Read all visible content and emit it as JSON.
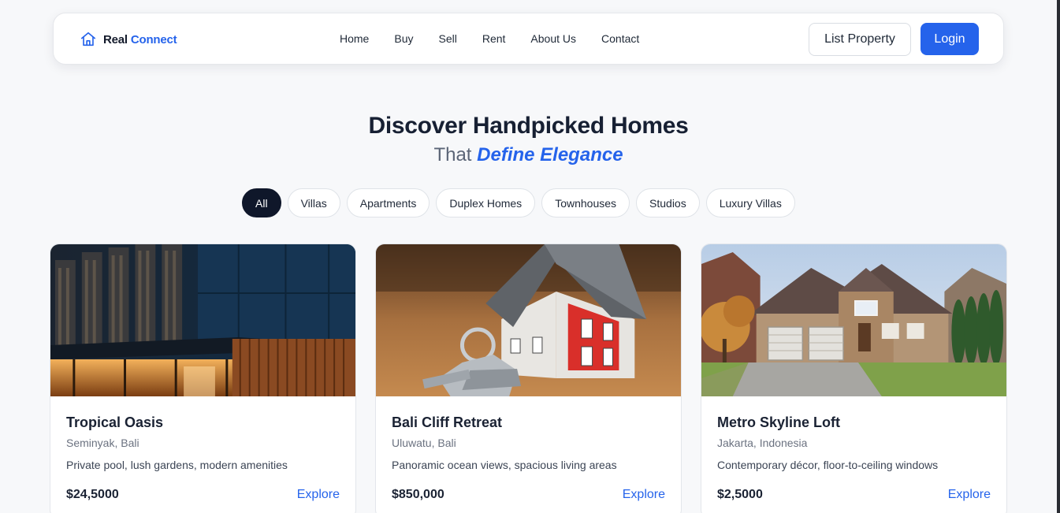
{
  "nav": {
    "brand_real": "Real",
    "brand_connect": "Connect",
    "links": [
      "Home",
      "Buy",
      "Sell",
      "Rent",
      "About Us",
      "Contact"
    ],
    "list_property": "List Property",
    "login": "Login"
  },
  "hero": {
    "title": "Discover Handpicked Homes",
    "subtitle_prefix": "That",
    "subtitle_accent": "Define Elegance"
  },
  "filters": [
    "All",
    "Villas",
    "Apartments",
    "Duplex Homes",
    "Townhouses",
    "Studios",
    "Luxury Villas"
  ],
  "cards": [
    {
      "title": "Tropical Oasis",
      "location": "Seminyak, Bali",
      "description": "Private pool, lush gardens, modern amenities",
      "price": "$24,5000",
      "cta": "Explore"
    },
    {
      "title": "Bali Cliff Retreat",
      "location": "Uluwatu, Bali",
      "description": "Panoramic ocean views, spacious living areas",
      "price": "$850,000",
      "cta": "Explore"
    },
    {
      "title": "Metro Skyline Loft",
      "location": "Jakarta, Indonesia",
      "description": "Contemporary décor, floor-to-ceiling windows",
      "price": "$2,5000",
      "cta": "Explore"
    }
  ],
  "colors": {
    "accent": "#2563eb",
    "dark": "#0f172a",
    "background": "#f7f8fa"
  },
  "icons": {
    "brand": "house-icon"
  }
}
